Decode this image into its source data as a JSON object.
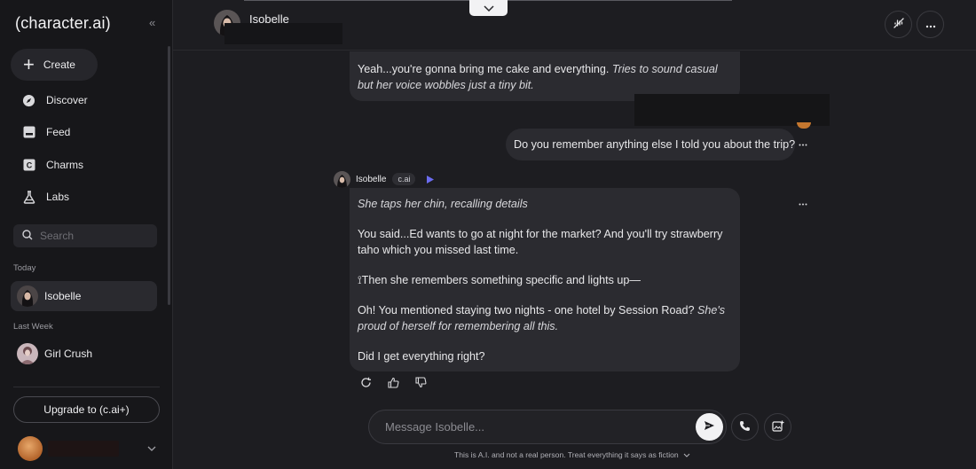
{
  "sidebar": {
    "logo": "(character.ai)",
    "create_label": "Create",
    "nav": [
      {
        "label": "Discover",
        "icon": "compass-icon"
      },
      {
        "label": "Feed",
        "icon": "feed-icon"
      },
      {
        "label": "Charms",
        "icon": "charms-icon"
      },
      {
        "label": "Labs",
        "icon": "flask-icon"
      }
    ],
    "search_placeholder": "Search",
    "section_today": "Today",
    "section_last_week": "Last Week",
    "chats": [
      {
        "name": "Isobelle",
        "active": true
      },
      {
        "name": "Girl Crush",
        "active": false
      }
    ],
    "upgrade_label": "Upgrade to (c.ai+)"
  },
  "header": {
    "character_name": "Isobelle"
  },
  "messages": {
    "msg1_text": "Yeah...you're gonna bring me cake and everything. ",
    "msg1_italic": "Tries to sound casual but her voice wobbles just a tiny bit.",
    "user_text": "Do you remember anything else I told you about the trip?",
    "char_name": "Isobelle",
    "char_badge": "c.ai",
    "msg2_p1": "She taps her chin, recalling details",
    "msg2_p2": "You said...Ed wants to go at night for the market? And you'll try strawberry taho which you missed last time.",
    "msg2_p3": "⟟Then she remembers something specific and lights up—",
    "msg2_p4a": "Oh! You mentioned staying two nights - one hotel by Session Road? ",
    "msg2_p4b": "She's proud of herself for remembering all this.",
    "msg2_p5": "Did I get everything right?"
  },
  "composer": {
    "placeholder": "Message Isobelle...",
    "disclaimer": "This is A.I. and not a real person. Treat everything it says as fiction"
  },
  "colors": {
    "background": "#1d1d21",
    "sidebar": "#17171a",
    "bubble": "#2b2b30",
    "play_accent": "#6b6cf0"
  }
}
